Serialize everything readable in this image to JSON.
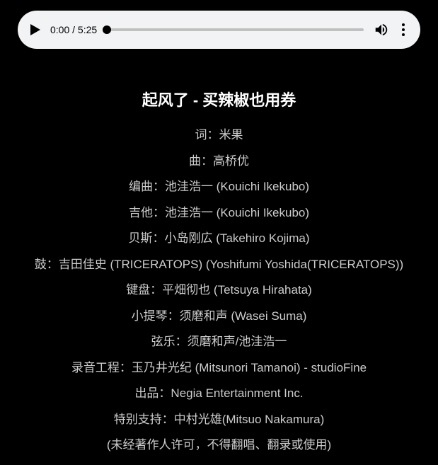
{
  "player": {
    "current_time": "0:00",
    "duration": "5:25",
    "time_display": "0:00 / 5:25"
  },
  "title": "起风了 - 买辣椒也用券",
  "credits": [
    "词：米果",
    "曲：高桥优",
    "编曲：池洼浩一 (Kouichi Ikekubo)",
    "吉他：池洼浩一 (Kouichi Ikekubo)",
    "贝斯：小岛刚広 (Takehiro Kojima)",
    "鼓：吉田佳史 (TRICERATOPS) (Yoshifumi Yoshida(TRICERATOPS))",
    "键盘：平畑彻也 (Tetsuya Hirahata)",
    "小提琴：须磨和声 (Wasei Suma)",
    "弦乐：须磨和声/池洼浩一",
    "录音工程：玉乃井光纪 (Mitsunori Tamanoi) - studioFine",
    "出品：Negia Entertainment Inc.",
    "特别支持：中村光雄(Mitsuo Nakamura)",
    "(未经著作人许可，不得翻唱、翻录或使用)"
  ]
}
